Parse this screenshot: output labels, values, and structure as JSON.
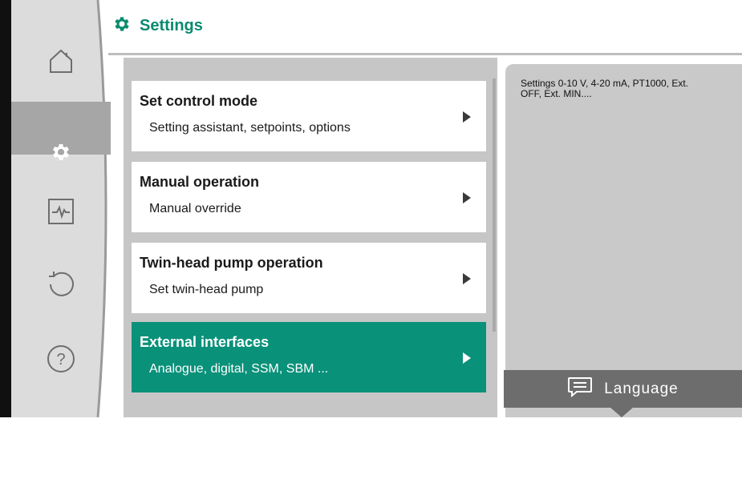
{
  "header": {
    "title": "Settings",
    "icon": "gear-icon"
  },
  "sidebar": {
    "items": [
      {
        "icon": "home-icon",
        "active": false
      },
      {
        "icon": "gear-icon",
        "active": true
      },
      {
        "icon": "diagnostics-icon",
        "active": false
      },
      {
        "icon": "undo-icon",
        "active": false
      },
      {
        "icon": "help-icon",
        "active": false
      }
    ]
  },
  "menu": {
    "items": [
      {
        "title": "Set control mode",
        "subtitle": "Setting assistant, setpoints, options"
      },
      {
        "title": "Manual operation",
        "subtitle": "Manual override"
      },
      {
        "title": "Twin-head pump operation",
        "subtitle": "Set twin-head pump"
      },
      {
        "title": "External interfaces",
        "subtitle": "Analogue, digital, SSM, SBM ...",
        "selected": true
      }
    ]
  },
  "info": {
    "text": "Settings 0-10 V, 4-20 mA, PT1000, Ext. OFF, Ext. MIN...."
  },
  "language_button": {
    "label": "Language"
  },
  "colors": {
    "accent": "#0a917a",
    "title": "#0a8a6e",
    "panel": "#c9c9c9",
    "sidebar_active": "#a6a6a6"
  }
}
